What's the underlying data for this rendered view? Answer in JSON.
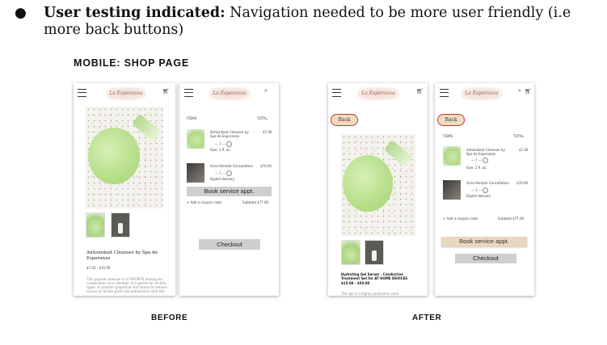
{
  "bullet": {
    "marker": "●",
    "label": "User testing indicated:",
    "text": " Navigation needed to be more user friendly (i.e more back buttons)"
  },
  "section_title": "MOBILE: SHOP PAGE",
  "captions": {
    "before": "BEFORE",
    "after": "AFTER"
  },
  "brand": {
    "logo_text": "La Esperanza"
  },
  "before_product": {
    "name": "Antioxidant Cleanser by Spa de Esperanza",
    "price": "$7.05 - $35.00",
    "description": "This popular cleanser is a FAVORITE among our combination skin clientele. It is gentle for all skin types. It contains grapefruit and lemon to remove excess oil as the green tea antioxidant calm the"
  },
  "cart": {
    "items_header": "ITEMS",
    "total_header": "TOTAL",
    "item1_name": "Antioxidant Cleanser by Spa de Esperanza",
    "item1_price": "$7.00",
    "item1_qty": "1",
    "item1_size": "Size: 1 fl. oz.",
    "item2_name": "Acne Remote Consultation",
    "item2_price": "$70.00",
    "item2_qty": "1",
    "item2_delivery": "Digital delivery",
    "book_label": "Book service appt.",
    "coupon_label": "+ Add a coupon code",
    "subtotal_label": "Subtotal $77.00",
    "checkout_label": "Checkout"
  },
  "after_product": {
    "back_label": "Back",
    "name": "Hydrating Gel Serum - Conductive Treatment Gel for AT HOME DEVICES",
    "price": "$15.00 - $50.00",
    "description": "This gel is a highly conductive clear"
  },
  "colors": {
    "accent_red": "#c0392b",
    "beige": "#e8d8bf",
    "gray_button": "#cfcfcf"
  }
}
